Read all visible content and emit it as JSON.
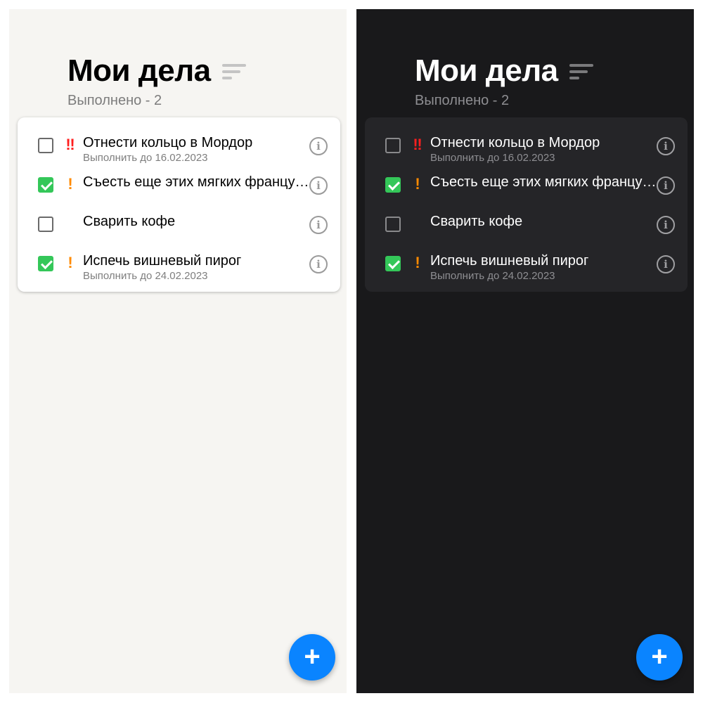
{
  "header": {
    "title": "Мои дела",
    "done_label": "Выполнено - 2"
  },
  "tasks": [
    {
      "title": "Отнести кольцо в Мордор",
      "deadline": "Выполнить до 16.02.2023",
      "priority": "‼",
      "checked": false
    },
    {
      "title": "Съесть еще этих мягких французских булок, да выпить же чаю",
      "deadline": "",
      "priority": "!",
      "checked": true
    },
    {
      "title": "Сварить кофе",
      "deadline": "",
      "priority": "",
      "checked": false
    },
    {
      "title": "Испечь вишневый пирог",
      "deadline": "Выполнить до 24.02.2023",
      "priority": "!",
      "checked": true
    }
  ],
  "icons": {
    "sort": "sort-icon",
    "info": "info-icon",
    "add": "plus-icon",
    "check": "checkmark-icon"
  },
  "fab_label": "+",
  "info_glyph": "i",
  "colors": {
    "light_background": "#f6f5f2",
    "dark_background": "#19191b",
    "accent": "#0a84ff",
    "checked": "#34c759",
    "priority_high": "#ff1f1f",
    "priority_medium": "#ff8a00"
  }
}
